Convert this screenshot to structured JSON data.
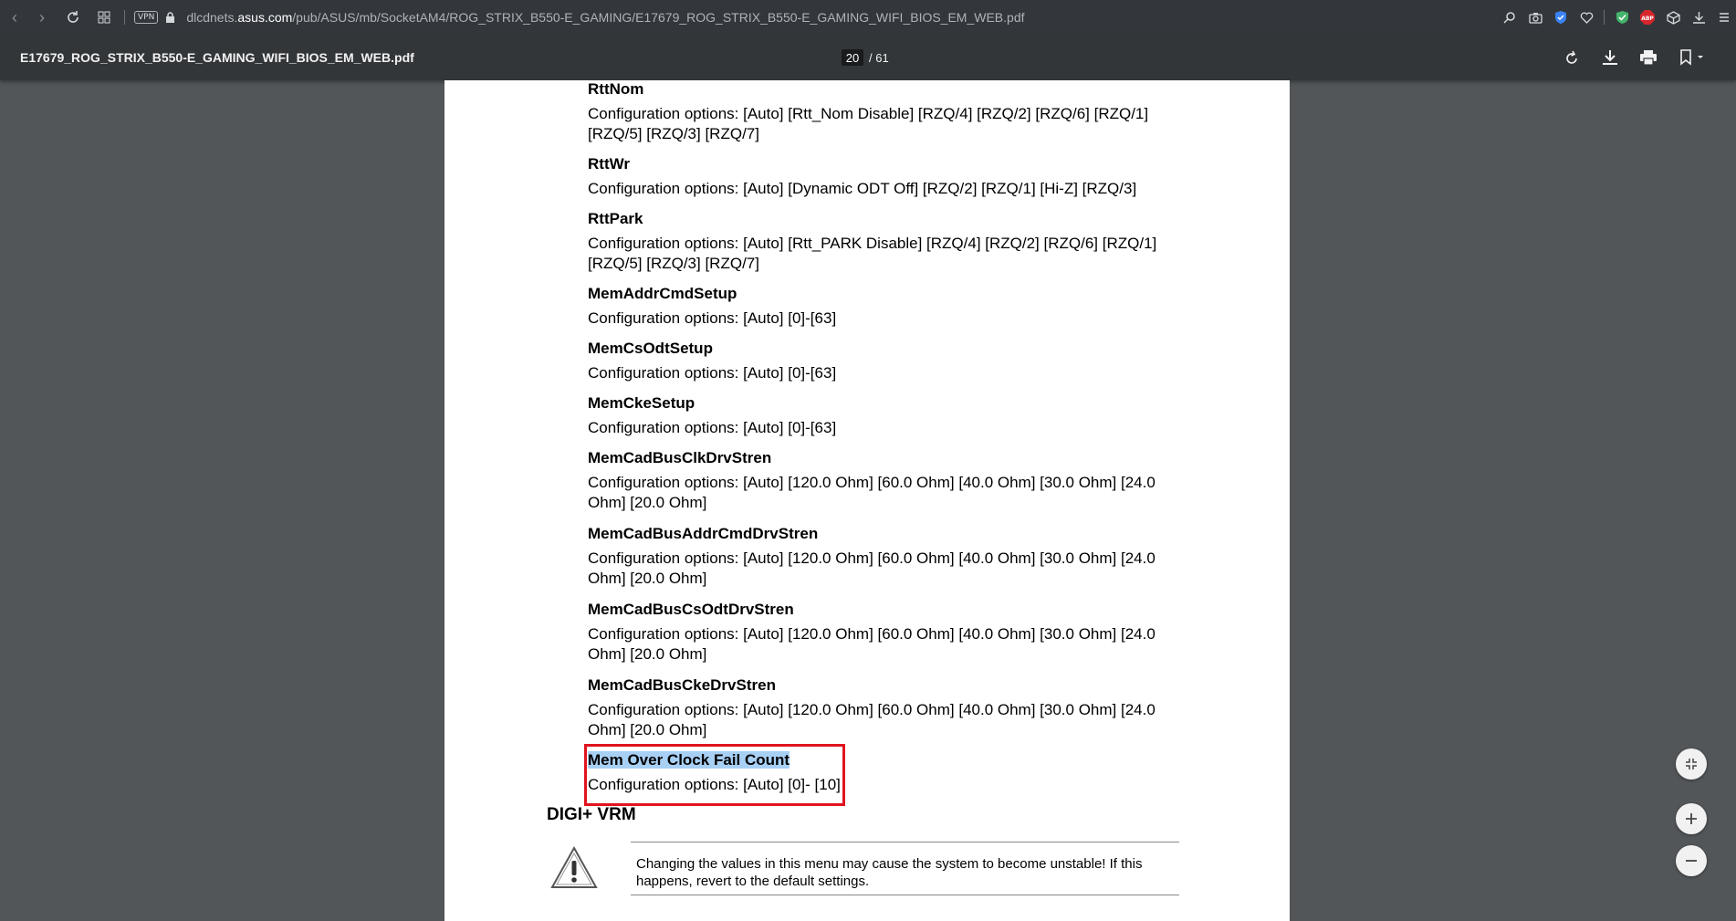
{
  "browser": {
    "vpn_label": "VPN",
    "url_host": "dlcdnets.asus.com",
    "url_prefix": "dlcdnets.",
    "url_domain": "asus.com",
    "url_path": "/pub/ASUS/mb/SocketAM4/ROG_STRIX_B550-E_GAMING/E17679_ROG_STRIX_B550-E_GAMING_WIFI_BIOS_EM_WEB.pdf",
    "abp_label": "ABP"
  },
  "pdf_toolbar": {
    "filename": "E17679_ROG_STRIX_B550-E_GAMING_WIFI_BIOS_EM_WEB.pdf",
    "current_page": "20",
    "total_pages": "/ 61"
  },
  "document": {
    "items": [
      {
        "title": "RttNom",
        "desc": "Configuration options: [Auto] [Rtt_Nom Disable] [RZQ/4] [RZQ/2] [RZQ/6] [RZQ/1] [RZQ/5] [RZQ/3] [RZQ/7]"
      },
      {
        "title": "RttWr",
        "desc": "Configuration options: [Auto] [Dynamic ODT Off] [RZQ/2] [RZQ/1] [Hi-Z] [RZQ/3]"
      },
      {
        "title": "RttPark",
        "desc": "Configuration options: [Auto] [Rtt_PARK Disable] [RZQ/4] [RZQ/2] [RZQ/6] [RZQ/1] [RZQ/5] [RZQ/3] [RZQ/7]"
      },
      {
        "title": "MemAddrCmdSetup",
        "desc": "Configuration options: [Auto] [0]-[63]"
      },
      {
        "title": "MemCsOdtSetup",
        "desc": "Configuration options: [Auto] [0]-[63]"
      },
      {
        "title": "MemCkeSetup",
        "desc": "Configuration options: [Auto] [0]-[63]"
      },
      {
        "title": "MemCadBusClkDrvStren",
        "desc": "Configuration options: [Auto] [120.0 Ohm] [60.0 Ohm] [40.0 Ohm] [30.0 Ohm] [24.0 Ohm] [20.0 Ohm]"
      },
      {
        "title": "MemCadBusAddrCmdDrvStren",
        "desc": "Configuration options: [Auto] [120.0 Ohm] [60.0 Ohm] [40.0 Ohm] [30.0 Ohm] [24.0 Ohm] [20.0 Ohm]"
      },
      {
        "title": "MemCadBusCsOdtDrvStren",
        "desc": "Configuration options: [Auto] [120.0 Ohm] [60.0 Ohm] [40.0 Ohm] [30.0 Ohm] [24.0 Ohm] [20.0 Ohm]"
      },
      {
        "title": "MemCadBusCkeDrvStren",
        "desc": "Configuration options: [Auto] [120.0 Ohm] [60.0 Ohm] [40.0 Ohm] [30.0 Ohm] [24.0 Ohm] [20.0 Ohm]"
      },
      {
        "title": "Mem Over Clock Fail Count",
        "desc": "Configuration options: [Auto] [0]- [10]"
      }
    ],
    "section_title": "DIGI+ VRM",
    "warning_text": "Changing the values in this menu may cause the system to become unstable! If this happens, revert to the default settings."
  },
  "colors": {
    "highlight_border": "#e0141f",
    "selection": "#a8d0f5",
    "toolbar": "#323639",
    "viewer_bg": "#525659"
  }
}
